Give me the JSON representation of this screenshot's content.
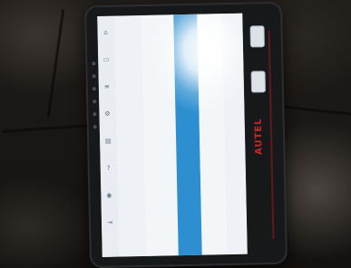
{
  "brand": {
    "logo_text": "AUTEL"
  },
  "screen": {
    "toolbar_icons": [
      "home-icon",
      "vehicle-icon",
      "menu-icon",
      "settings-icon",
      "print-icon",
      "help-icon",
      "camera-icon",
      "exit-icon"
    ],
    "highlight_color": "#2e8fd0",
    "side_buttons": 2
  }
}
